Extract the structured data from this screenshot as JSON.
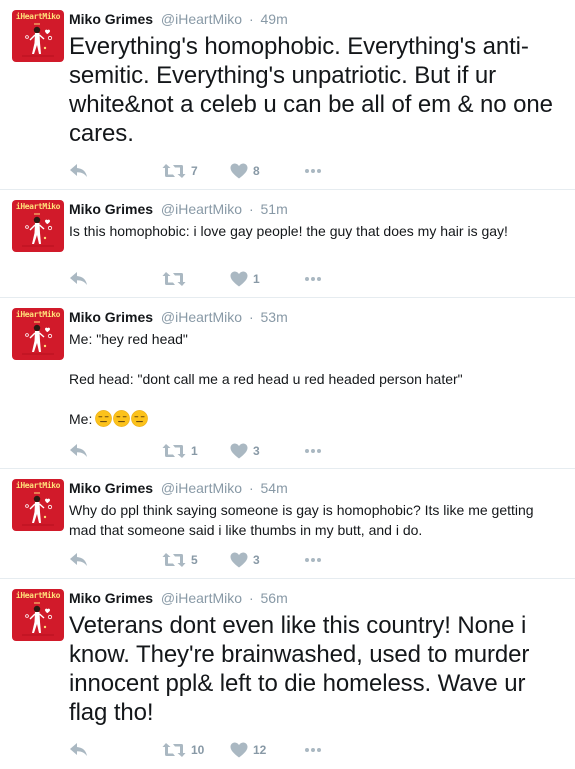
{
  "tweets": [
    {
      "name": "Miko Grimes",
      "handle": "@iHeartMiko",
      "separator": "·",
      "time": "49m",
      "text": "Everything's homophobic. Everything's anti-semitic. Everything's unpatriotic. But if ur white&not a celeb u can be all of em & no one cares.",
      "retweets": "7",
      "likes": "8"
    },
    {
      "name": "Miko Grimes",
      "handle": "@iHeartMiko",
      "separator": "·",
      "time": "51m",
      "text": "Is this homophobic: i love gay people! the guy that does my hair is gay!",
      "retweets": "",
      "likes": "1"
    },
    {
      "name": "Miko Grimes",
      "handle": "@iHeartMiko",
      "separator": "·",
      "time": "53m",
      "text": "Me: \"hey red head\"\n\nRed head: \"dont call me a red head u red headed person hater\"\n\nMe:",
      "emoji_count": "3",
      "retweets": "1",
      "likes": "3"
    },
    {
      "name": "Miko Grimes",
      "handle": "@iHeartMiko",
      "separator": "·",
      "time": "54m",
      "text": "Why do ppl think saying someone is gay is homophobic? Its like me getting mad that someone said i like thumbs in my butt, and i do.",
      "retweets": "5",
      "likes": "3"
    },
    {
      "name": "Miko Grimes",
      "handle": "@iHeartMiko",
      "separator": "·",
      "time": "56m",
      "text": "Veterans dont even like this country! None i know. They're brainwashed, used to murder innocent ppl& left to die homeless. Wave ur flag tho!",
      "retweets": "10",
      "likes": "12"
    }
  ],
  "avatar": {
    "label": "iHeartMiko",
    "bg": "#d11a2a",
    "text_color": "#ffe07a"
  },
  "icons": {
    "reply": "reply-arrow-icon",
    "retweet": "retweet-icon",
    "like": "heart-icon",
    "more": "more-dots-icon",
    "emoji": "expressionless-face-emoji"
  },
  "colors": {
    "text": "#14171a",
    "muted": "#8899a6",
    "icon": "#aab8c2",
    "divider": "#e6ecf0"
  }
}
